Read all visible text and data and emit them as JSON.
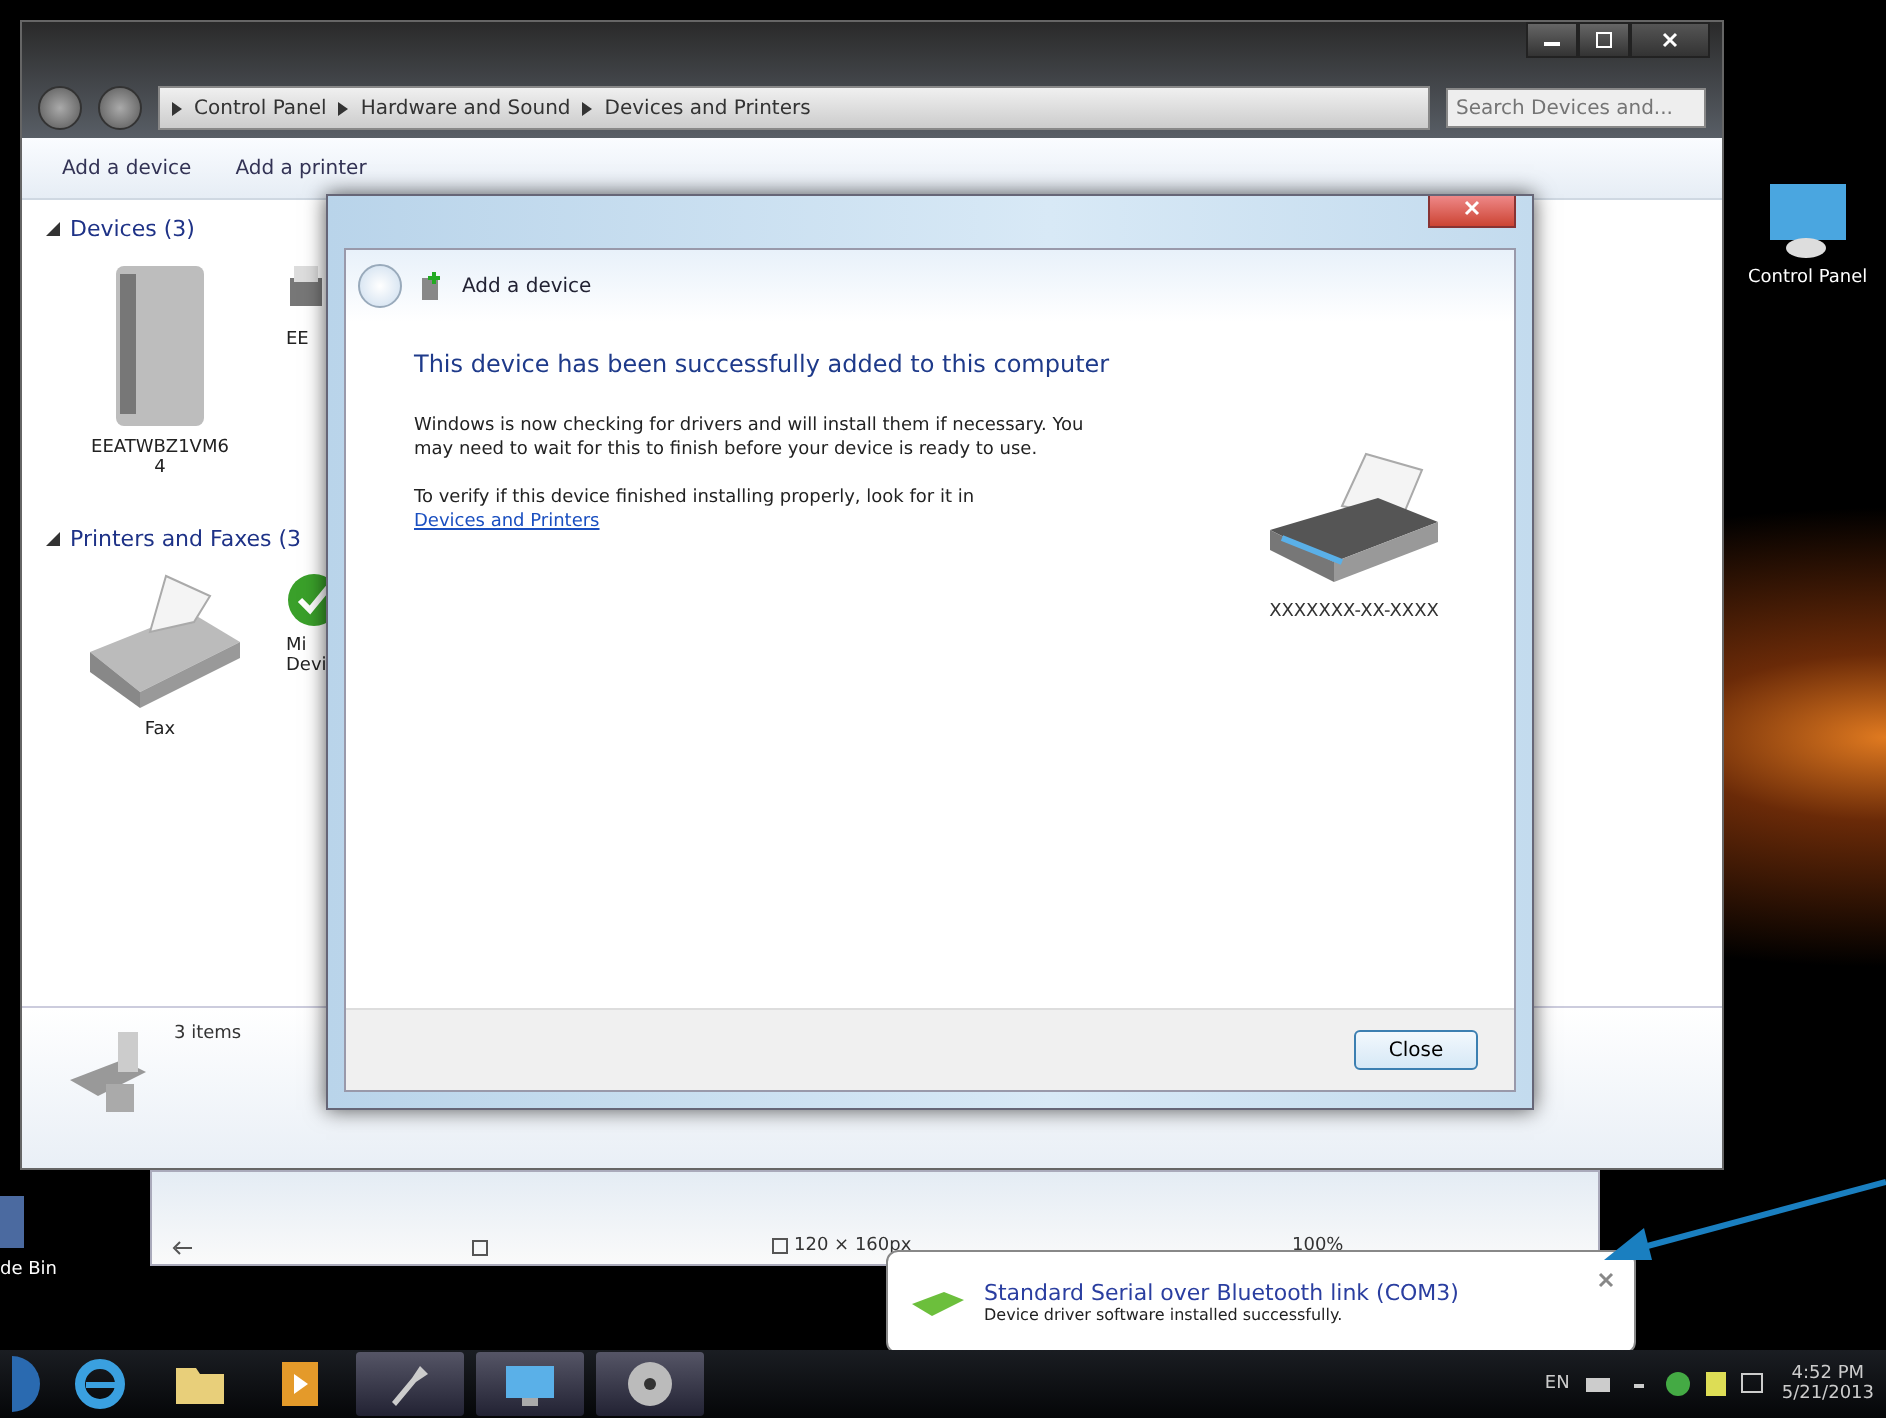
{
  "explorer": {
    "breadcrumb": [
      "Control Panel",
      "Hardware and Sound",
      "Devices and Printers"
    ],
    "search": {
      "placeholder": "Search Devices and..."
    },
    "toolbar": [
      "Add a device",
      "Add a printer"
    ],
    "groups": [
      {
        "title": "Devices (3)",
        "expanded": true,
        "items": [
          {
            "label": "EEATWBZ1VM64",
            "kind": "drive"
          },
          {
            "label": "EE",
            "kind": "printer"
          }
        ]
      },
      {
        "title": "Printers and Faxes (3",
        "expanded": true,
        "items": [
          {
            "label": "Fax",
            "kind": "fax"
          },
          {
            "label": "Mi Devi",
            "kind": "check"
          }
        ]
      }
    ],
    "details": "3 items"
  },
  "dialog": {
    "title": "Add a device",
    "heading": "This device has been successfully added to this computer",
    "paragraphs": [
      "Windows is now checking for drivers and will install them if necessary. You may need to wait for this to finish before your device is ready to use.",
      "To verify if this device finished installing properly, look for it in"
    ],
    "link": "Devices and Printers",
    "device_label": "XXXXXXX-XX-XXXX",
    "close_button": "Close"
  },
  "viewer_status": {
    "size": "120 × 160px",
    "zoom": "100%"
  },
  "desktop_icons": [
    {
      "label": "Control Panel",
      "kind": "control"
    },
    {
      "label": "de Bin",
      "kind": "bin"
    }
  ],
  "taskbar": {
    "apps": [
      {
        "kind": "ie"
      },
      {
        "kind": "folder"
      },
      {
        "kind": "media"
      },
      {
        "kind": "tool"
      },
      {
        "kind": "network"
      },
      {
        "kind": "disc"
      }
    ],
    "tray": {
      "language": "EN",
      "time": "4:52 PM",
      "date": "5/21/2013"
    }
  },
  "balloon": {
    "title": "Standard Serial over Bluetooth link (COM3)",
    "message": "Device driver software installed successfully."
  }
}
